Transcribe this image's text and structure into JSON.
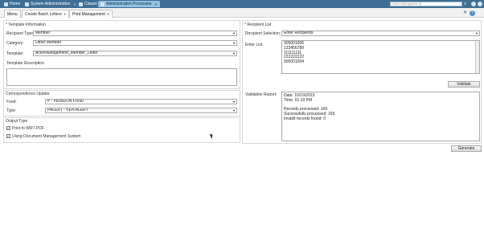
{
  "top_tabs": [
    {
      "label": "Home"
    },
    {
      "label": "System Administration"
    },
    {
      "label": "Classic"
    },
    {
      "label": "Administration Processes"
    }
  ],
  "search": {
    "placeholder": "enter distinguised ID"
  },
  "sub_tabs": [
    {
      "label": "Menu"
    },
    {
      "label": "Create Batch Letters"
    },
    {
      "label": "Print Management"
    }
  ],
  "template_info": {
    "title": "* Template Information",
    "recipient_type_label": "Recipient Type:",
    "recipient_type_value": "Member",
    "category_label": "Category:",
    "category_value": "Other Member",
    "template_label": "Template:",
    "template_value": "Acknowledgement_Member_Letter",
    "description_label": "Template Description:"
  },
  "correspondence": {
    "title": "Correspondence Update",
    "fund_label": "Fund:",
    "fund_value": "P - PENSION FUND",
    "type_label": "Type:",
    "type_value": "PALERT - PEN ALERT"
  },
  "output_type": {
    "title": "Output Type",
    "options": [
      {
        "label": "Print to WRT-PDF",
        "checked": true
      },
      {
        "label": "Using Document Management System",
        "checked": true
      }
    ]
  },
  "recipient_list": {
    "title": "* Recipient List",
    "selection_label": "Recipient Selection:",
    "selection_value": "Enter Recipients",
    "enter_list_label": "Enter List:",
    "entries": [
      "905001006",
      "123456789",
      "111111111",
      "222222222",
      "905001004"
    ],
    "validate_label": "Validate"
  },
  "validation": {
    "label": "Validation Report:",
    "date": "Date: 10/19/2023",
    "time": "Time: 01:19 PM",
    "records_processed": "Records processed: 169",
    "successfully_processed": "Successfully processed: 169",
    "invalid_records": "Invalid records found: 0"
  },
  "generate_label": "Generate",
  "colors": {
    "titlebar": "#3e6e95",
    "active_tab": "#8fc1e0"
  }
}
